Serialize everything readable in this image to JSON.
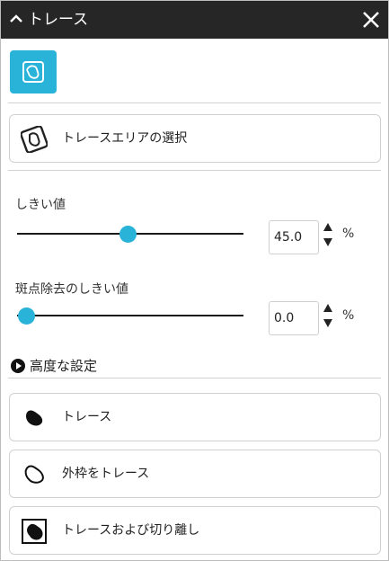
{
  "titlebar": {
    "title": "トレース",
    "collapse_icon": "chevron-up-icon",
    "close_icon": "close-icon"
  },
  "tool_icon": {
    "icon": "trace-tool-icon",
    "accent": "#2ab3d8"
  },
  "select_area": {
    "label": "トレースエリアの選択",
    "icon": "trace-area-icon"
  },
  "threshold": {
    "label": "しきい値",
    "value": "45.0",
    "unit": "%",
    "slider_fraction": 0.45
  },
  "despeckle": {
    "label": "斑点除去のしきい値",
    "value": "0.0",
    "unit": "%",
    "slider_fraction": 0.0
  },
  "advanced": {
    "label": "高度な設定",
    "icon": "play-circle-icon"
  },
  "actions": [
    {
      "label": "トレース",
      "icon": "trace-fill-icon"
    },
    {
      "label": "外枠をトレース",
      "icon": "trace-outline-icon"
    },
    {
      "label": "トレースおよび切り離し",
      "icon": "trace-cut-icon"
    }
  ]
}
